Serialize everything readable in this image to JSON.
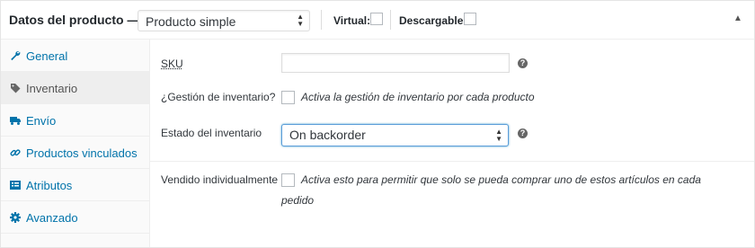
{
  "header": {
    "title": "Datos del producto —",
    "product_type": "Producto simple",
    "virtual_label": "Virtual:",
    "downloadable_label": "Descargable:",
    "collapse_icon": "triangle-up-icon"
  },
  "sidebar": {
    "items": [
      {
        "label": "General",
        "icon": "wrench-icon",
        "active": false
      },
      {
        "label": "Inventario",
        "icon": "tag-icon",
        "active": true
      },
      {
        "label": "Envío",
        "icon": "truck-icon",
        "active": false
      },
      {
        "label": "Productos vinculados",
        "icon": "link-icon",
        "active": false
      },
      {
        "label": "Atributos",
        "icon": "list-icon",
        "active": false
      },
      {
        "label": "Avanzado",
        "icon": "gear-icon",
        "active": false
      }
    ]
  },
  "inventory": {
    "sku_label": "SKU",
    "sku_value": "",
    "manage_stock_label": "¿Gestión de inventario?",
    "manage_stock_desc": "Activa la gestión de inventario por cada producto",
    "stock_status_label": "Estado del inventario",
    "stock_status_value": "On backorder",
    "sold_individually_label": "Vendido individualmente",
    "sold_individually_desc_line1": "Activa esto para permitir que solo se pueda comprar uno de estos artículos en cada",
    "sold_individually_desc_line2": "pedido",
    "help_icon": "question-icon"
  },
  "colors": {
    "link": "#0073aa",
    "focus_border": "#5b9dd9",
    "active_tab_bg": "#eeeeee"
  }
}
